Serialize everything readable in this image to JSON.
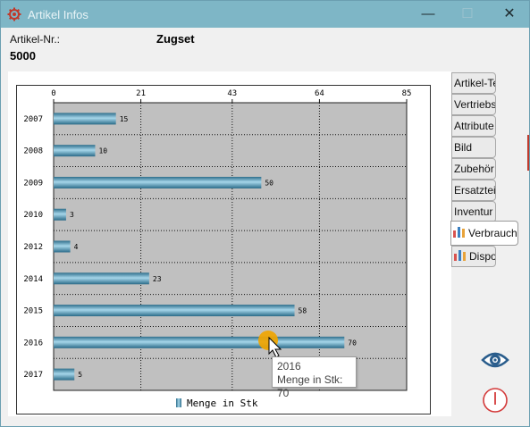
{
  "window": {
    "title": "Artikel Infos",
    "minimize_glyph": "—",
    "maximize_glyph": "☐",
    "close_glyph": "✕"
  },
  "header": {
    "artikel_label": "Artikel-Nr.:",
    "artikel_value": "5000",
    "name": "Zugset"
  },
  "tabs": [
    {
      "label": "Artikel-Texte"
    },
    {
      "label": "Vertriebsinfo"
    },
    {
      "label": "Attribute"
    },
    {
      "label": "Bild"
    },
    {
      "label": "Zubehör"
    },
    {
      "label": "Ersatzteile"
    },
    {
      "label": "Inventur"
    },
    {
      "label": "Verbrauch",
      "active": true,
      "icon": "bar-chart-icon"
    },
    {
      "label": "Dispo",
      "icon": "bar-chart-icon"
    }
  ],
  "tooltip": {
    "line1": "2016",
    "line2": "Menge in Stk: 70"
  },
  "chart_data": {
    "type": "bar",
    "orientation": "horizontal",
    "categories": [
      "2007",
      "2008",
      "2009",
      "2010",
      "2012",
      "2014",
      "2015",
      "2016",
      "2017"
    ],
    "series": [
      {
        "name": "Menge in Stk",
        "values": [
          15,
          10,
          50,
          3,
          4,
          23,
          58,
          70,
          5
        ]
      }
    ],
    "x_ticks": [
      "0",
      "21",
      "43",
      "64",
      "85"
    ],
    "xlim": [
      0,
      85
    ],
    "grid": true,
    "legend_position": "bottom",
    "colors": {
      "bar": "#3d8fb5",
      "plot_bg": "#c0c0c0",
      "highlight": "#f0a500"
    }
  },
  "icons": {
    "eye": "eye-icon",
    "stop": "stop-icon"
  }
}
